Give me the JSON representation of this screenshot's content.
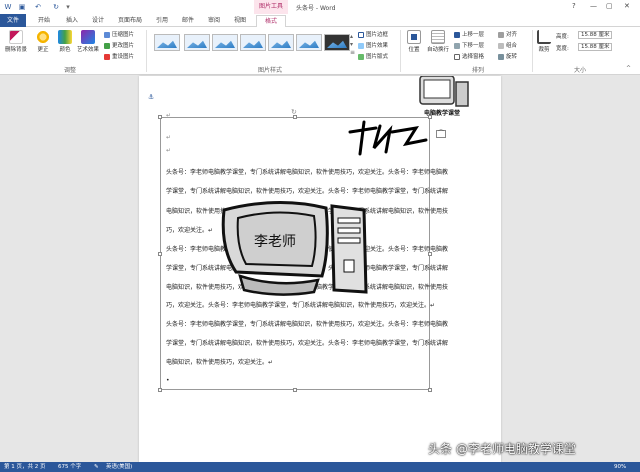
{
  "window": {
    "title": "头条号 - Word",
    "tool_tab_header": "图片工具",
    "help": "?",
    "minimize": "—",
    "restore": "▢",
    "close": "✕"
  },
  "tabs": [
    "文件",
    "开始",
    "插入",
    "设计",
    "页面布局",
    "引用",
    "邮件",
    "审阅",
    "视图",
    "格式"
  ],
  "ribbon": {
    "adjust": {
      "remove_bg": "删除背景",
      "corrections": "更正",
      "color": "颜色",
      "artistic": "艺术效果",
      "compress": "压缩图片",
      "change": "更改图片",
      "reset": "重设图片",
      "label": "调整"
    },
    "styles": {
      "border": "图片边框",
      "effects": "图片效果",
      "layout": "图片版式",
      "label": "图片样式"
    },
    "arrange": {
      "position": "位置",
      "wrap": "自动换行",
      "forward": "上移一层",
      "backward": "下移一层",
      "selection_pane": "选择窗格",
      "align": "对齐",
      "group": "组合",
      "rotate": "旋转",
      "label": "排列"
    },
    "size": {
      "crop": "裁剪",
      "height_label": "高度:",
      "height_value": "15.88 厘米",
      "width_label": "宽度:",
      "width_value": "15.88 厘米",
      "label": "大小"
    }
  },
  "document": {
    "logo_caption": "电脑教学课堂",
    "para_mark": "↵",
    "lines": [
      "头条号：李老师电脑教学课堂，专门系统讲解电脑知识，软件使用技巧，欢迎关注。头条号：李老师电脑教",
      "学课堂，专门系统讲解电脑知识，软件使用技巧，欢迎关注。头条号：李老师电脑教学课堂，专门系统讲解",
      "电脑知识，软件使用技巧，欢迎关注。头条号：李老师电脑教学课堂，专门系统讲解电脑知识，软件使用技",
      "巧，欢迎关注。↵",
      "头条号：李老师电脑教学课堂，专门系统讲解电脑知识，软件使用技巧，欢迎关注。头条号：李老师电脑教",
      "学课堂，专门系统讲解电脑知识，软件使用技巧，欢迎关注。头条号：李老师电脑教学课堂，专门系统讲解",
      "电脑知识，软件使用技巧，欢迎关注。头条号：李老师电脑教学课堂，专门系统讲解电脑知识，软件使用技",
      "巧，欢迎关注。头条号：李老师电脑教学课堂，专门系统讲解电脑知识，软件使用技巧，欢迎关注。↵",
      "头条号：李老师电脑教学课堂，专门系统讲解电脑知识，软件使用技巧，欢迎关注。头条号：李老师电脑教",
      "学课堂，专门系统讲解电脑知识，软件使用技巧，欢迎关注。头条号：李老师电脑教学课堂，专门系统讲解",
      "电脑知识，软件使用技巧，欢迎关注。↵"
    ],
    "monitor_screen_text": "李老师"
  },
  "status": {
    "page": "第 1 页，共 2 页",
    "words": "675 个字",
    "language": "英语(美国)",
    "zoom": "90%"
  },
  "watermark": "头条 @李老师电脑教学课堂",
  "colors": {
    "accent": "#2b579a",
    "tool_tab": "#b0306a"
  }
}
